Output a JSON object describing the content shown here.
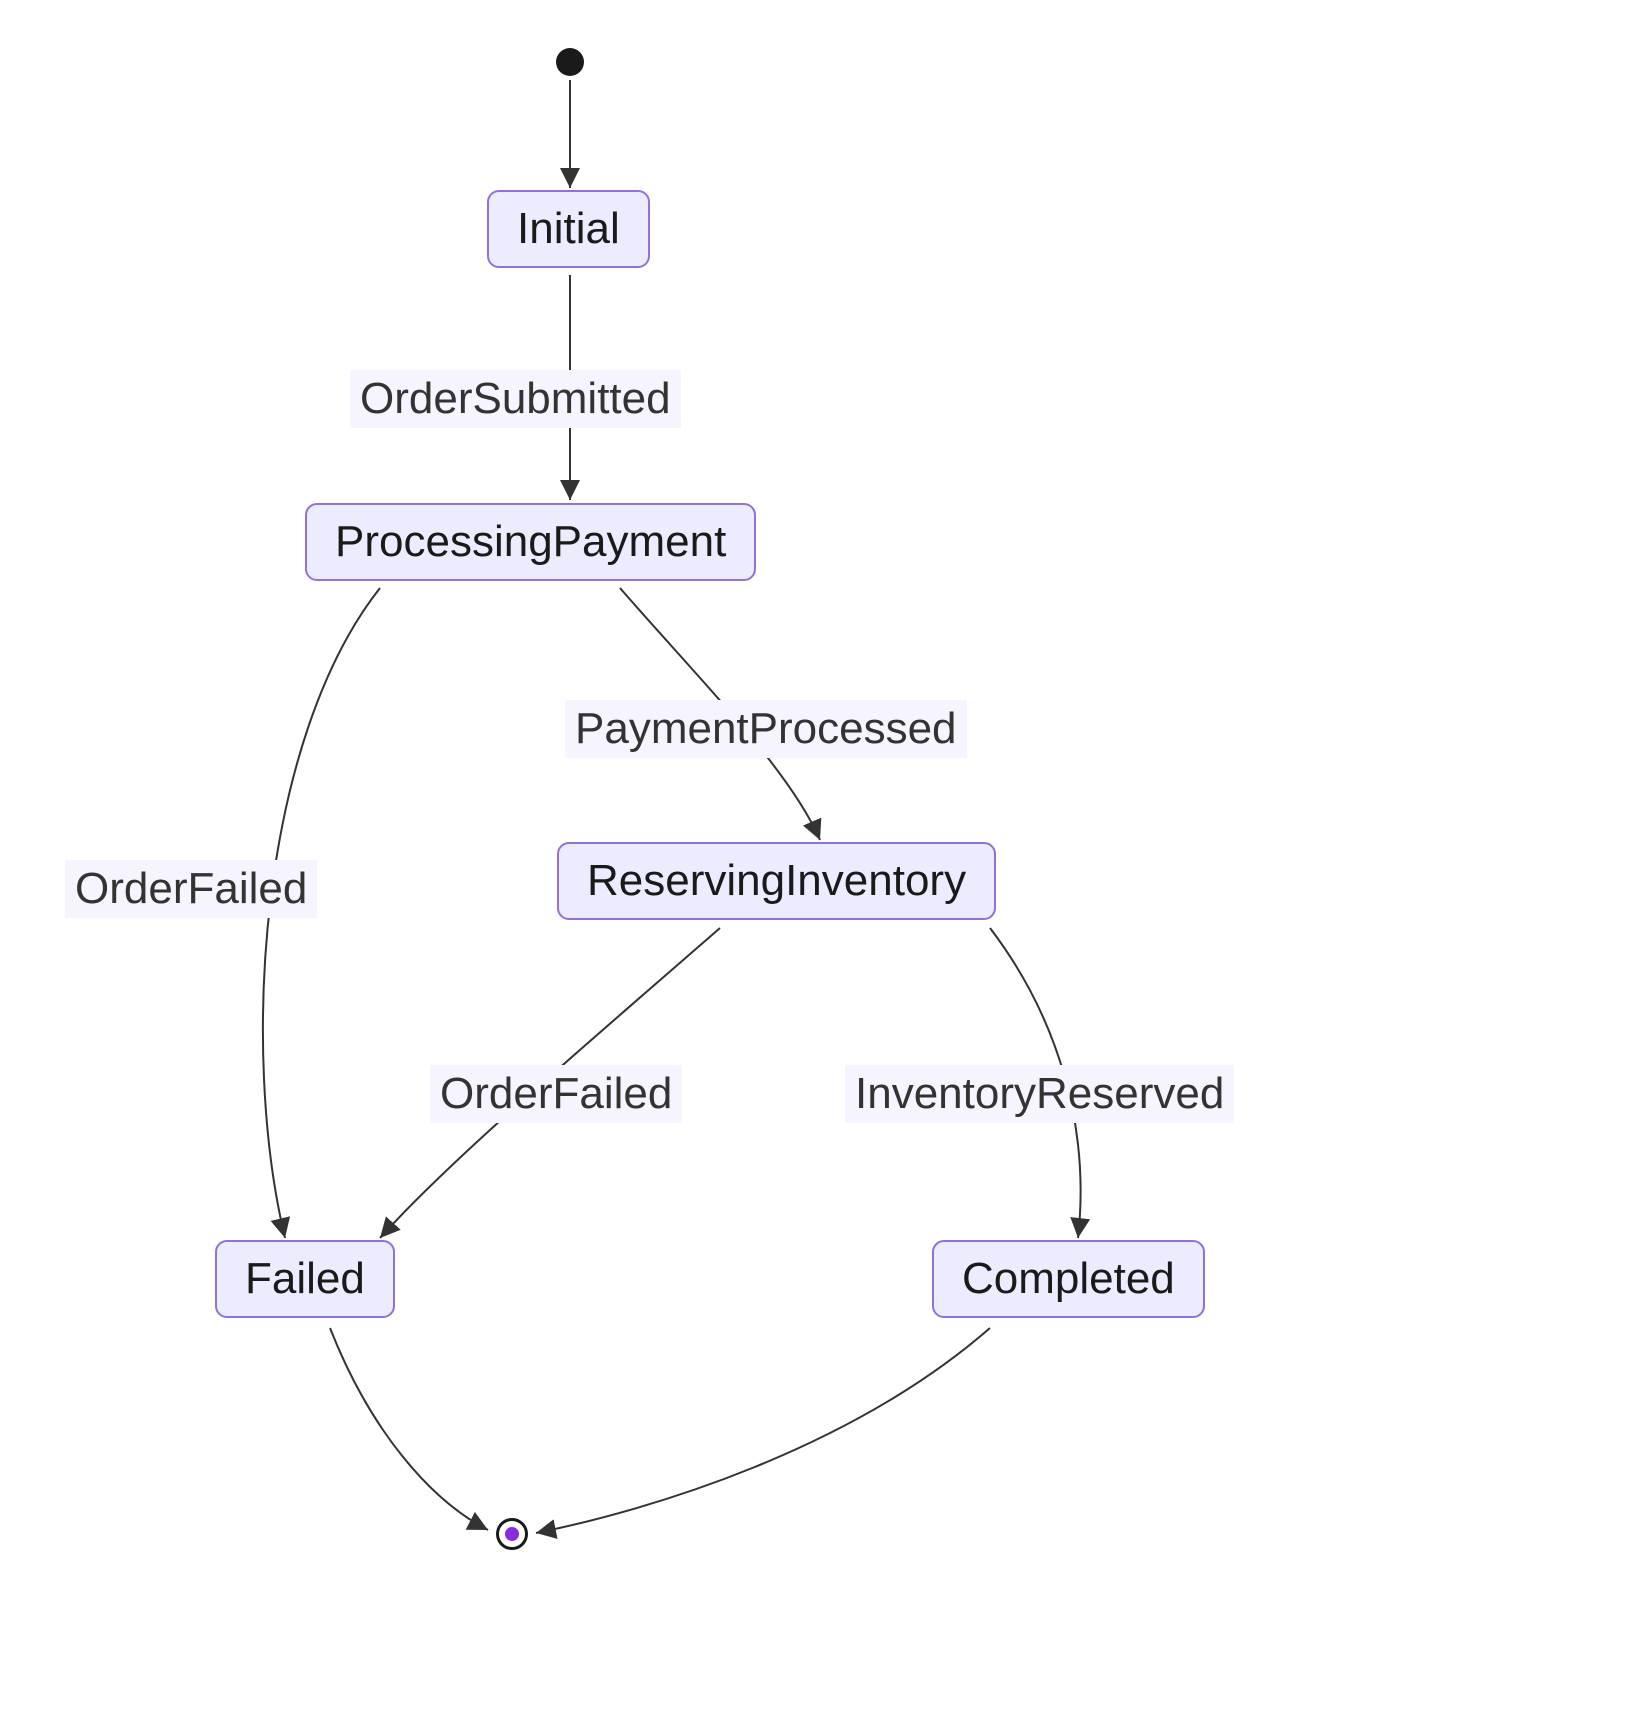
{
  "chart_data": {
    "type": "state_diagram",
    "states": [
      {
        "id": "start",
        "type": "start"
      },
      {
        "id": "initial",
        "label": "Initial"
      },
      {
        "id": "processing_payment",
        "label": "ProcessingPayment"
      },
      {
        "id": "reserving_inventory",
        "label": "ReservingInventory"
      },
      {
        "id": "failed",
        "label": "Failed"
      },
      {
        "id": "completed",
        "label": "Completed"
      },
      {
        "id": "end",
        "type": "end"
      }
    ],
    "transitions": [
      {
        "from": "start",
        "to": "initial",
        "label": ""
      },
      {
        "from": "initial",
        "to": "processing_payment",
        "label": "OrderSubmitted"
      },
      {
        "from": "processing_payment",
        "to": "reserving_inventory",
        "label": "PaymentProcessed"
      },
      {
        "from": "processing_payment",
        "to": "failed",
        "label": "OrderFailed"
      },
      {
        "from": "reserving_inventory",
        "to": "completed",
        "label": "InventoryReserved"
      },
      {
        "from": "reserving_inventory",
        "to": "failed",
        "label": "OrderFailed"
      },
      {
        "from": "failed",
        "to": "end",
        "label": ""
      },
      {
        "from": "completed",
        "to": "end",
        "label": ""
      }
    ]
  },
  "nodes": {
    "initial": "Initial",
    "processing_payment": "ProcessingPayment",
    "reserving_inventory": "ReservingInventory",
    "failed": "Failed",
    "completed": "Completed"
  },
  "labels": {
    "order_submitted": "OrderSubmitted",
    "payment_processed": "PaymentProcessed",
    "order_failed_1": "OrderFailed",
    "order_failed_2": "OrderFailed",
    "inventory_reserved": "InventoryReserved"
  }
}
